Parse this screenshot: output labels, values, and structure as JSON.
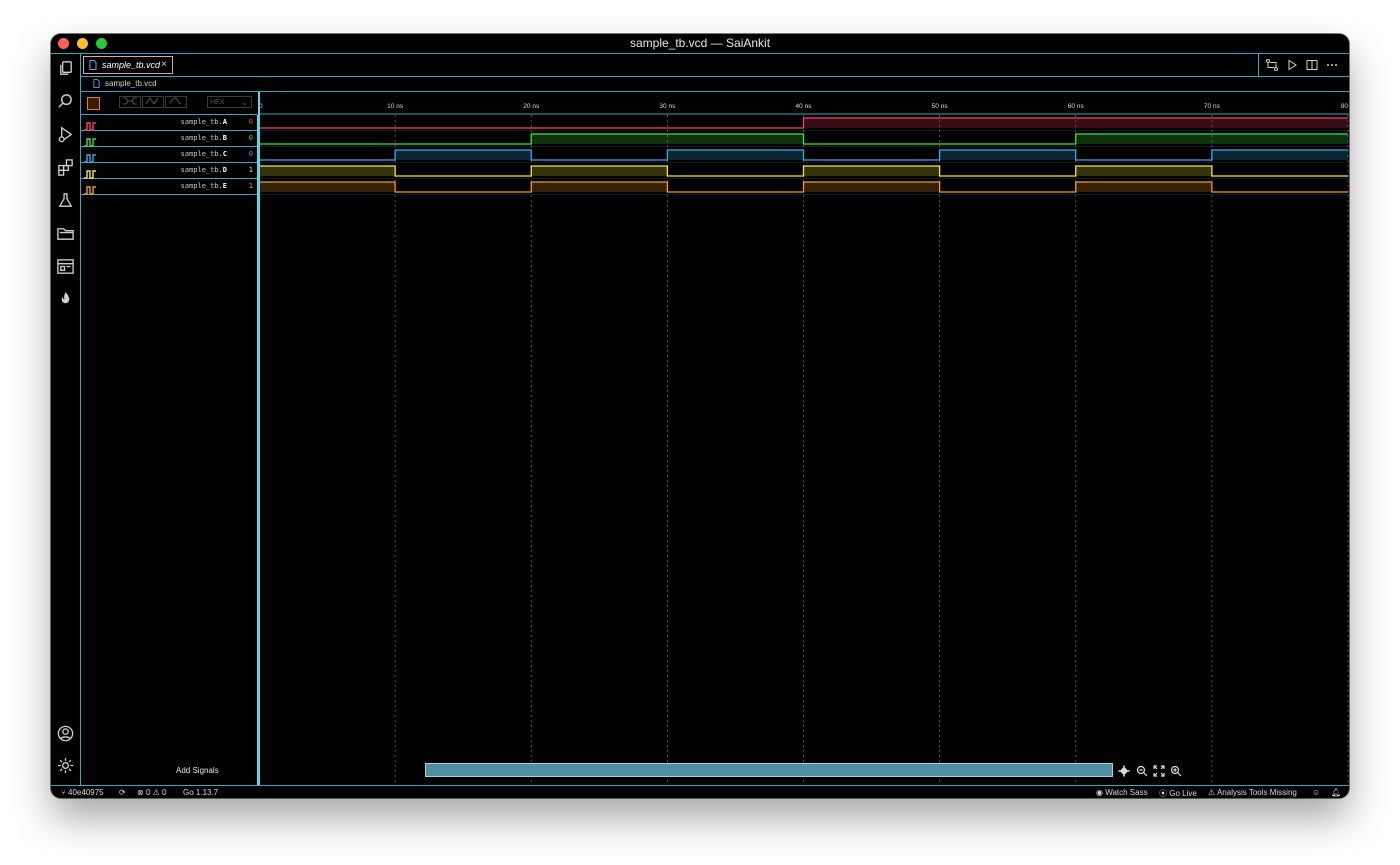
{
  "window": {
    "title": "sample_tb.vcd — SaiAnkit"
  },
  "tab": {
    "label": "sample_tb.vcd",
    "close": "×"
  },
  "breadcrumb": {
    "label": "sample_tb.vcd"
  },
  "toolbar": {
    "format": "HEX"
  },
  "signals": [
    {
      "name_prefix": "sample_tb.",
      "name_bold": "A",
      "value": "0",
      "color": "#ff3b6b"
    },
    {
      "name_prefix": "sample_tb.",
      "name_bold": "B",
      "value": "0",
      "color": "#3ee23e"
    },
    {
      "name_prefix": "sample_tb.",
      "name_bold": "C",
      "value": "0",
      "color": "#38a8e8"
    },
    {
      "name_prefix": "sample_tb.",
      "name_bold": "D",
      "value": "1",
      "color": "#f2e833"
    },
    {
      "name_prefix": "sample_tb.",
      "name_bold": "E",
      "value": "1",
      "color": "#f59a2a"
    }
  ],
  "waves": [
    [
      [
        0,
        0
      ],
      [
        40,
        1
      ]
    ],
    [
      [
        0,
        0
      ],
      [
        20,
        1
      ],
      [
        40,
        0
      ],
      [
        60,
        1
      ]
    ],
    [
      [
        0,
        0
      ],
      [
        10,
        1
      ],
      [
        20,
        0
      ],
      [
        30,
        1
      ],
      [
        40,
        0
      ],
      [
        50,
        1
      ],
      [
        60,
        0
      ],
      [
        70,
        1
      ]
    ],
    [
      [
        0,
        1
      ],
      [
        10,
        0
      ],
      [
        20,
        1
      ],
      [
        30,
        0
      ],
      [
        40,
        1
      ],
      [
        50,
        0
      ],
      [
        60,
        1
      ],
      [
        70,
        0
      ]
    ],
    [
      [
        0,
        1
      ],
      [
        10,
        0
      ],
      [
        20,
        1
      ],
      [
        30,
        0
      ],
      [
        40,
        1
      ],
      [
        50,
        0
      ],
      [
        60,
        1
      ],
      [
        70,
        0
      ]
    ]
  ],
  "timeline": {
    "ticks": [
      {
        "t": 0,
        "label": "0"
      },
      {
        "t": 10,
        "label": "10 ns"
      },
      {
        "t": 20,
        "label": "20 ns"
      },
      {
        "t": 30,
        "label": "30 ns"
      },
      {
        "t": 40,
        "label": "40 ns"
      },
      {
        "t": 50,
        "label": "50 ns"
      },
      {
        "t": 60,
        "label": "60 ns"
      },
      {
        "t": 70,
        "label": "70 ns"
      },
      {
        "t": 80,
        "label": "80"
      }
    ],
    "end": 80
  },
  "add_signals": "Add Signals",
  "statusbar": {
    "branch": "40e40975",
    "errors": "0",
    "warnings": "0",
    "go": "Go 1.13.7",
    "watch_sass": "Watch Sass",
    "go_live": "Go Live",
    "analysis": "Analysis Tools Missing"
  },
  "colors": {
    "accent": "#2fa8c2",
    "cursor": "#5fd3e8",
    "scrollbar": "#4f8fa0"
  }
}
